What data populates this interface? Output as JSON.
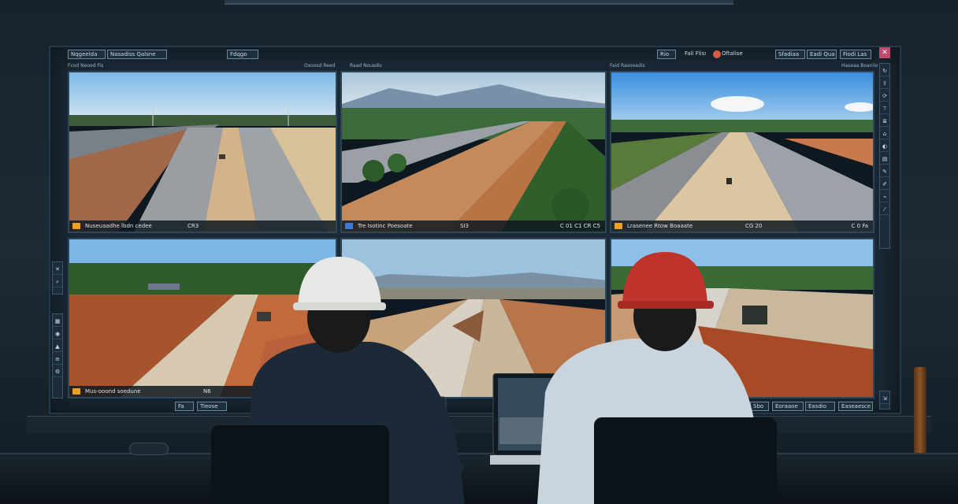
{
  "topbar": {
    "left_buttons": [
      "Nqgeelda",
      "Nasadiss Qalsne",
      "Fdqgo"
    ],
    "right_buttons": [
      "Rio",
      "Fali Fliss",
      "Oftalise",
      "Sfadiaa",
      "Eadi Qua",
      "Fiodi Las"
    ]
  },
  "top_labels": {
    "col1": "Fcod Neoed Fis",
    "col2a": "Oxoosd Reed",
    "col2b": "Raad Nousdis",
    "col3": "Faid Rasoeadis",
    "col3b": "Haseaa Boaniio"
  },
  "panels": [
    {
      "caption": "Nuseuaadhe lbdn cedee",
      "time": "CR3",
      "extra": "",
      "icon": "orange"
    },
    {
      "caption": "Tre Isotinc Poesoate",
      "time": "SI3",
      "extra": "C 01  C1 CR  C5",
      "icon": "blue"
    },
    {
      "caption": "Lrasenee Rtow Boaaate",
      "time": "CG 20",
      "extra": "C 0 Fa",
      "icon": "orange"
    },
    {
      "caption": "Mus-ooond soedune",
      "time": "N6",
      "extra": "",
      "icon": "orange"
    },
    {
      "caption": "",
      "time": "",
      "extra": "",
      "icon": "none"
    },
    {
      "caption": "",
      "time": "",
      "extra": "",
      "icon": "none"
    }
  ],
  "bottombar": {
    "left_buttons": [
      "Fa",
      "Tieose"
    ],
    "right_buttons": [
      "Sbo",
      "Eoraaoe",
      "Easdio",
      "Easeaesce"
    ]
  },
  "colors": {
    "sky": "#8ec3e8",
    "dirt": "#c98c5a",
    "gravel": "#8f9499",
    "forest": "#2f5f2a",
    "accent_orange": "#f0a020",
    "helmet_white": "#e8e9e6",
    "helmet_red": "#c0332a"
  }
}
